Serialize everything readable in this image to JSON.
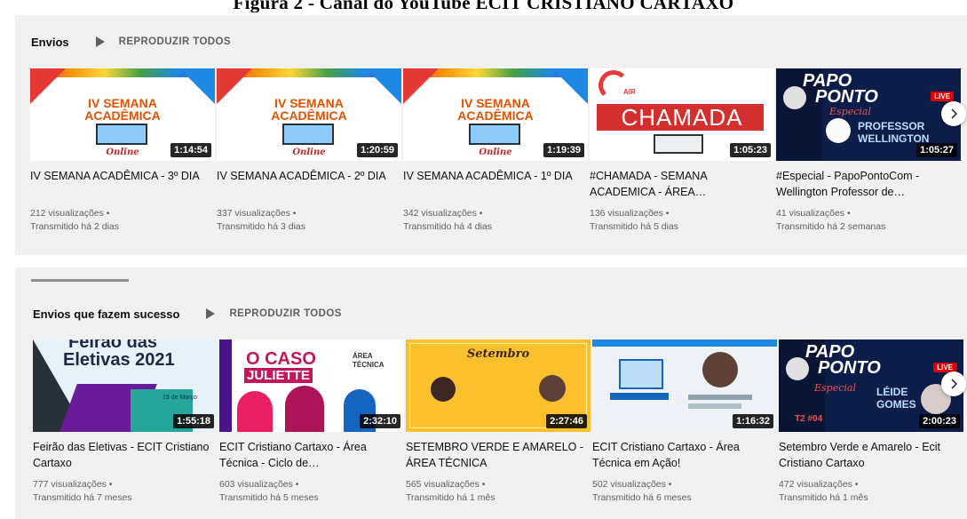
{
  "caption": "Figura 2 - Canal do YouTube ECIT CRISTIANO CARTAXO",
  "shelves": [
    {
      "title": "Envios",
      "play_all": "REPRODUZIR TODOS",
      "videos": [
        {
          "title": "IV SEMANA ACADÊMICA - 3º DIA",
          "views": "212 visualizações",
          "time": "Transmitido há 2 dias",
          "duration": "1:14:54",
          "thumb_text": [
            "IV SEMANA",
            "ACADÊMICA"
          ],
          "thumb_script": "Online"
        },
        {
          "title": "IV SEMANA ACADÊMICA - 2º DIA",
          "views": "337 visualizações",
          "time": "Transmitido há 3 dias",
          "duration": "1:20:59",
          "thumb_text": [
            "IV SEMANA",
            "ACADÊMICA"
          ],
          "thumb_script": "Online"
        },
        {
          "title": "IV SEMANA ACADÊMICA - 1º DIA",
          "views": "342 visualizações",
          "time": "Transmitido há 4 dias",
          "duration": "1:19:39",
          "thumb_text": [
            "IV SEMANA",
            "ACADÊMICA"
          ],
          "thumb_script": "Online"
        },
        {
          "title": "#CHAMADA - SEMANA ACADEMICA - ÁREA…",
          "views": "136 visualizações",
          "time": "Transmitido há 5 dias",
          "duration": "1:05:23",
          "thumb_text": [
            "CHAMADA"
          ],
          "thumb_script": "AIR"
        },
        {
          "title": "#Especial - PapoPontoCom - Wellington Professor de…",
          "views": "41 visualizações",
          "time": "Transmitido há 2 semanas",
          "duration": "1:05:27",
          "thumb_text": [
            "PAPO",
            "PONTO",
            "PROFESSOR",
            "WELLINGTON"
          ],
          "thumb_script": "Especial"
        }
      ]
    },
    {
      "title": "Envios que fazem sucesso",
      "play_all": "REPRODUZIR TODOS",
      "videos": [
        {
          "title": "Feirão das Eletivas - ECIT Cristiano Cartaxo",
          "views": "777 visualizações",
          "time": "Transmitido há 7 meses",
          "duration": "1:55:18",
          "thumb_text": [
            "Feirão das",
            "Eletivas 2021"
          ],
          "thumb_script": "19 de Março"
        },
        {
          "title": "ECIT Cristiano Cartaxo - Área Técnica - Ciclo de…",
          "views": "603 visualizações",
          "time": "Transmitido há 5 meses",
          "duration": "2:32:10",
          "thumb_text": [
            "O CASO",
            "JULIETTE",
            "ÁREA",
            "TÉCNICA"
          ],
          "thumb_script": ""
        },
        {
          "title": "SETEMBRO VERDE E AMARELO - ÁREA TÉCNICA",
          "views": "565 visualizações",
          "time": "Transmitido há 1 mês",
          "duration": "2:27:46",
          "thumb_text": [
            "Setembro"
          ],
          "thumb_script": ""
        },
        {
          "title": "ECIT Cristiano Cartaxo - Área Técnica em Ação!",
          "views": "502 visualizações",
          "time": "Transmitido há 6 meses",
          "duration": "1:16:32",
          "thumb_text": [],
          "thumb_script": ""
        },
        {
          "title": "Setembro Verde e Amarelo - Ecit Cristiano Cartaxo",
          "views": "472 visualizações",
          "time": "Transmitido há 1 mês",
          "duration": "2:00:23",
          "thumb_text": [
            "PAPO",
            "PONTO",
            "LÉIDE",
            "GOMES",
            "T2 #04"
          ],
          "thumb_script": "Especial"
        }
      ]
    }
  ],
  "colors": {
    "shelf_bg": "#f1f1f1",
    "meta": "#606060",
    "title": "#0f0f0f",
    "live_red": "#e00000",
    "podcast_blue": "#0d1d4a"
  }
}
